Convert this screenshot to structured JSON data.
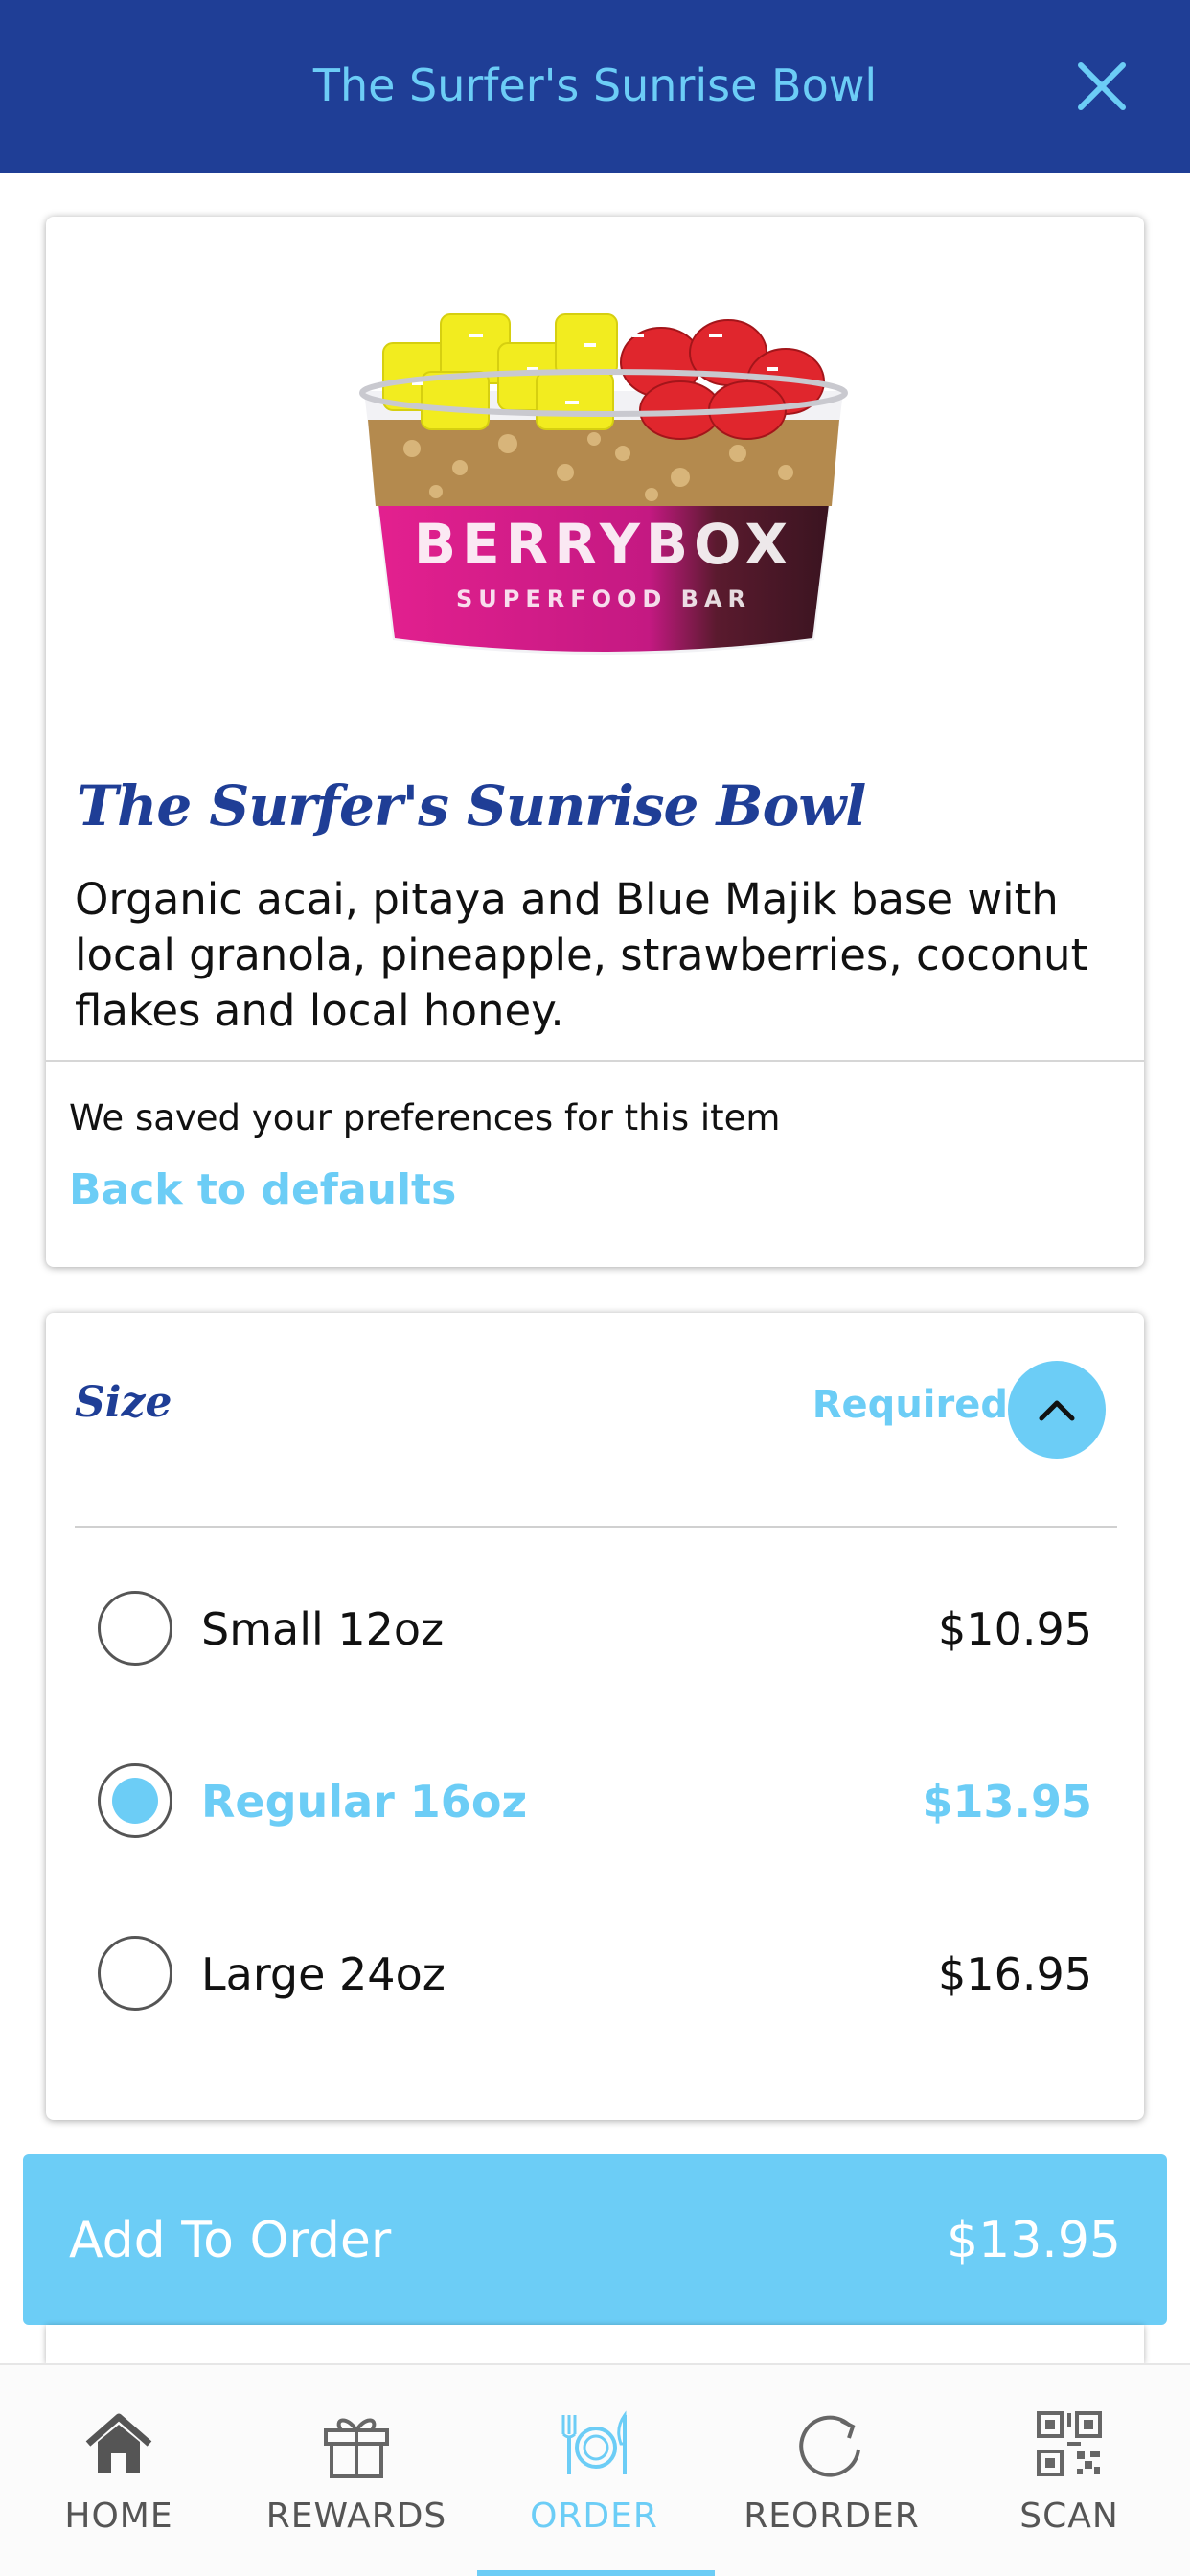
{
  "header": {
    "title": "The Surfer's Sunrise Bowl"
  },
  "item": {
    "title": "The Surfer's Sunrise Bowl",
    "description": "Organic acai, pitaya and Blue Majik base with local granola, pineapple, strawberries, coconut flakes and local honey.",
    "image_text": {
      "brand": "BERRYBOX",
      "subtitle": "SUPERFOOD BAR"
    },
    "preferences_note": "We saved your preferences for this item",
    "defaults_link": "Back to defaults"
  },
  "size": {
    "title": "Size",
    "required_label": "Required",
    "options": [
      {
        "label": "Small 12oz",
        "price": "$10.95",
        "selected": false
      },
      {
        "label": "Regular 16oz",
        "price": "$13.95",
        "selected": true
      },
      {
        "label": "Large 24oz",
        "price": "$16.95",
        "selected": false
      }
    ]
  },
  "add_button": {
    "label": "Add To Order",
    "price": "$13.95"
  },
  "tabs": [
    {
      "label": "HOME",
      "icon": "home-icon",
      "active": false
    },
    {
      "label": "REWARDS",
      "icon": "gift-icon",
      "active": false
    },
    {
      "label": "ORDER",
      "icon": "utensils-icon",
      "active": true
    },
    {
      "label": "REORDER",
      "icon": "reorder-icon",
      "active": false
    },
    {
      "label": "SCAN",
      "icon": "qr-code-icon",
      "active": false
    }
  ],
  "colors": {
    "header_bg": "#1f3e96",
    "accent": "#6ccdf6",
    "title": "#1f3e96"
  }
}
